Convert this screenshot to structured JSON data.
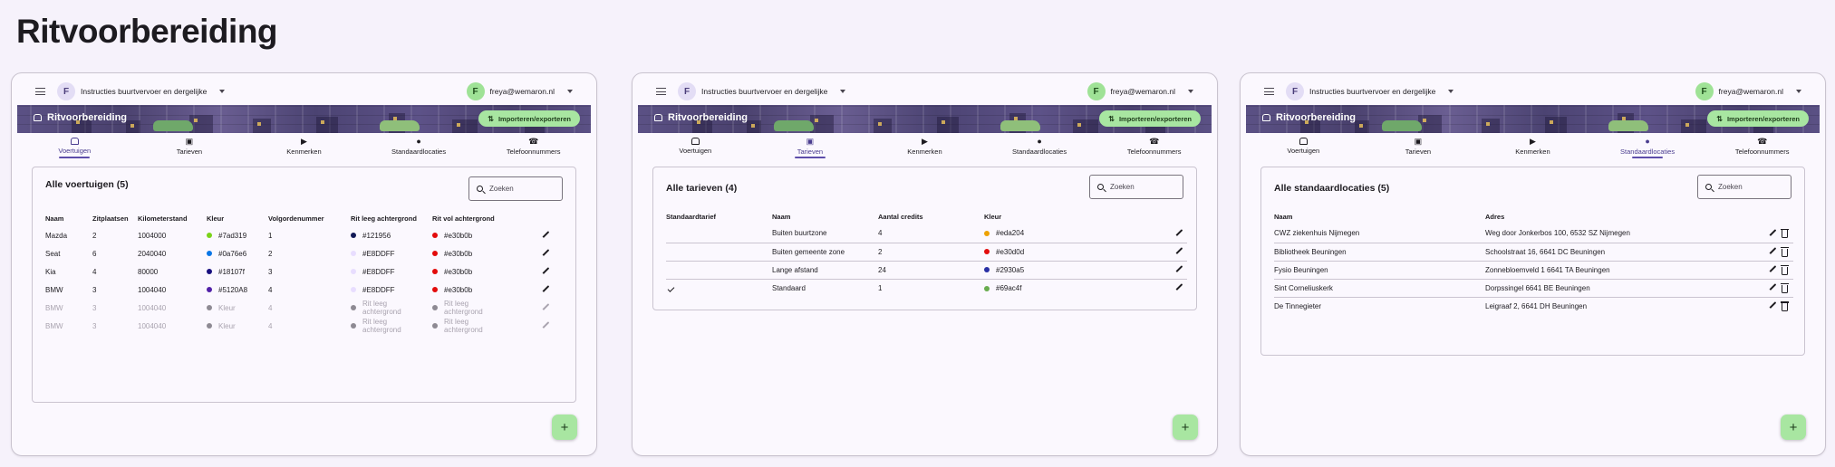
{
  "page_title": "Ritvoorbereiding",
  "colors": {
    "banner": "#4f4775",
    "accent_green": "#a8e6a1",
    "active_tab": "#4a3d8f"
  },
  "screens": [
    {
      "org_avatar": "F",
      "org_name": "Instructies buurtvervoer en dergelijke",
      "user_avatar": "F",
      "user_email": "freya@wemaron.nl",
      "banner_title": "Ritvoorbereiding",
      "import_label": "Importeren/exporteren",
      "tabs": [
        {
          "label": "Voertuigen",
          "icon": "car-icon"
        },
        {
          "label": "Tarieven",
          "icon": "wallet-icon"
        },
        {
          "label": "Kenmerken",
          "icon": "label-icon"
        },
        {
          "label": "Standaardlocaties",
          "icon": "pin-icon"
        },
        {
          "label": "Telefoonnummers",
          "icon": "phone-icon"
        }
      ],
      "active_tab": 0,
      "card_title": "Alle voertuigen (5)",
      "search_placeholder": "Zoeken",
      "columns": [
        "Naam",
        "Zitplaatsen",
        "Kilometerstand",
        "Kleur",
        "Volgordenummer",
        "Rit leeg achtergrond",
        "Rit vol achtergrond"
      ],
      "rows": [
        {
          "naam": "Mazda",
          "zit": "2",
          "km": "1004000",
          "kleur": "#7ad319",
          "volg": "1",
          "leeg": "#121956",
          "vol": "#e30b0b"
        },
        {
          "naam": "Seat",
          "zit": "6",
          "km": "2040040",
          "kleur": "#0a76e6",
          "volg": "2",
          "leeg": "#E8DDFF",
          "vol": "#e30b0b"
        },
        {
          "naam": "Kia",
          "zit": "4",
          "km": "80000",
          "kleur": "#18107f",
          "volg": "3",
          "leeg": "#E8DDFF",
          "vol": "#e30b0b"
        },
        {
          "naam": "BMW",
          "zit": "3",
          "km": "1004040",
          "kleur": "#5120A8",
          "volg": "4",
          "leeg": "#E8DDFF",
          "vol": "#e30b0b"
        }
      ],
      "dim_rows": [
        {
          "naam": "BMW",
          "zit": "3",
          "km": "1004040",
          "kleur": "Kleur",
          "volg": "4",
          "leeg1": "Rit leeg",
          "leeg2": "achtergrond",
          "vol1": "Rit leeg",
          "vol2": "achtergrond"
        },
        {
          "naam": "BMW",
          "zit": "3",
          "km": "1004040",
          "kleur": "Kleur",
          "volg": "4",
          "leeg1": "Rit leeg",
          "leeg2": "achtergrond",
          "vol1": "Rit leeg",
          "vol2": "achtergrond"
        }
      ]
    },
    {
      "org_avatar": "F",
      "org_name": "Instructies buurtvervoer en dergelijke",
      "user_avatar": "F",
      "user_email": "freya@wemaron.nl",
      "banner_title": "Ritvoorbereiding",
      "import_label": "Importeren/exporteren",
      "tabs": [
        {
          "label": "Voertuigen",
          "icon": "car-icon"
        },
        {
          "label": "Tarieven",
          "icon": "wallet-icon"
        },
        {
          "label": "Kenmerken",
          "icon": "label-icon"
        },
        {
          "label": "Standaardlocaties",
          "icon": "pin-icon"
        },
        {
          "label": "Telefoonnummers",
          "icon": "phone-icon"
        }
      ],
      "active_tab": 1,
      "card_title": "Alle tarieven (4)",
      "search_placeholder": "Zoeken",
      "columns": [
        "Standaardtarief",
        "Naam",
        "Aantal credits",
        "Kleur"
      ],
      "rows": [
        {
          "standaard": false,
          "naam": "Buiten buurtzone",
          "credits": "4",
          "kleur": "#eda204"
        },
        {
          "standaard": false,
          "naam": "Buiten gemeente zone",
          "credits": "2",
          "kleur": "#e30d0d"
        },
        {
          "standaard": false,
          "naam": "Lange afstand",
          "credits": "24",
          "kleur": "#2930a5"
        },
        {
          "standaard": true,
          "naam": "Standaard",
          "credits": "1",
          "kleur": "#69ac4f"
        }
      ]
    },
    {
      "org_avatar": "F",
      "org_name": "Instructies buurtvervoer en dergelijke",
      "user_avatar": "F",
      "user_email": "freya@wemaron.nl",
      "banner_title": "Ritvoorbereiding",
      "import_label": "Importeren/exporteren",
      "tabs": [
        {
          "label": "Voertuigen",
          "icon": "car-icon"
        },
        {
          "label": "Tarieven",
          "icon": "wallet-icon"
        },
        {
          "label": "Kenmerken",
          "icon": "label-icon"
        },
        {
          "label": "Standaardlocaties",
          "icon": "pin-icon"
        },
        {
          "label": "Telefoonnummers",
          "icon": "phone-icon"
        }
      ],
      "active_tab": 3,
      "card_title": "Alle standaardlocaties (5)",
      "search_placeholder": "Zoeken",
      "columns": [
        "Naam",
        "Adres"
      ],
      "rows": [
        {
          "naam": "CWZ ziekenhuis Nijmegen",
          "adres": "Weg door Jonkerbos 100, 6532 SZ Nijmegen"
        },
        {
          "naam": "Bibliotheek Beuningen",
          "adres": "Schoolstraat 16, 6641 DC Beuningen"
        },
        {
          "naam": "Fysio Beuningen",
          "adres": "Zonnebloemveld 1 6641 TA Beuningen"
        },
        {
          "naam": "Sint Corneliuskerk",
          "adres": "Dorpssingel 6641 BE Beuningen"
        },
        {
          "naam": "De Tinnegieter",
          "adres": "Leigraaf 2, 6641 DH Beuningen"
        }
      ]
    }
  ]
}
